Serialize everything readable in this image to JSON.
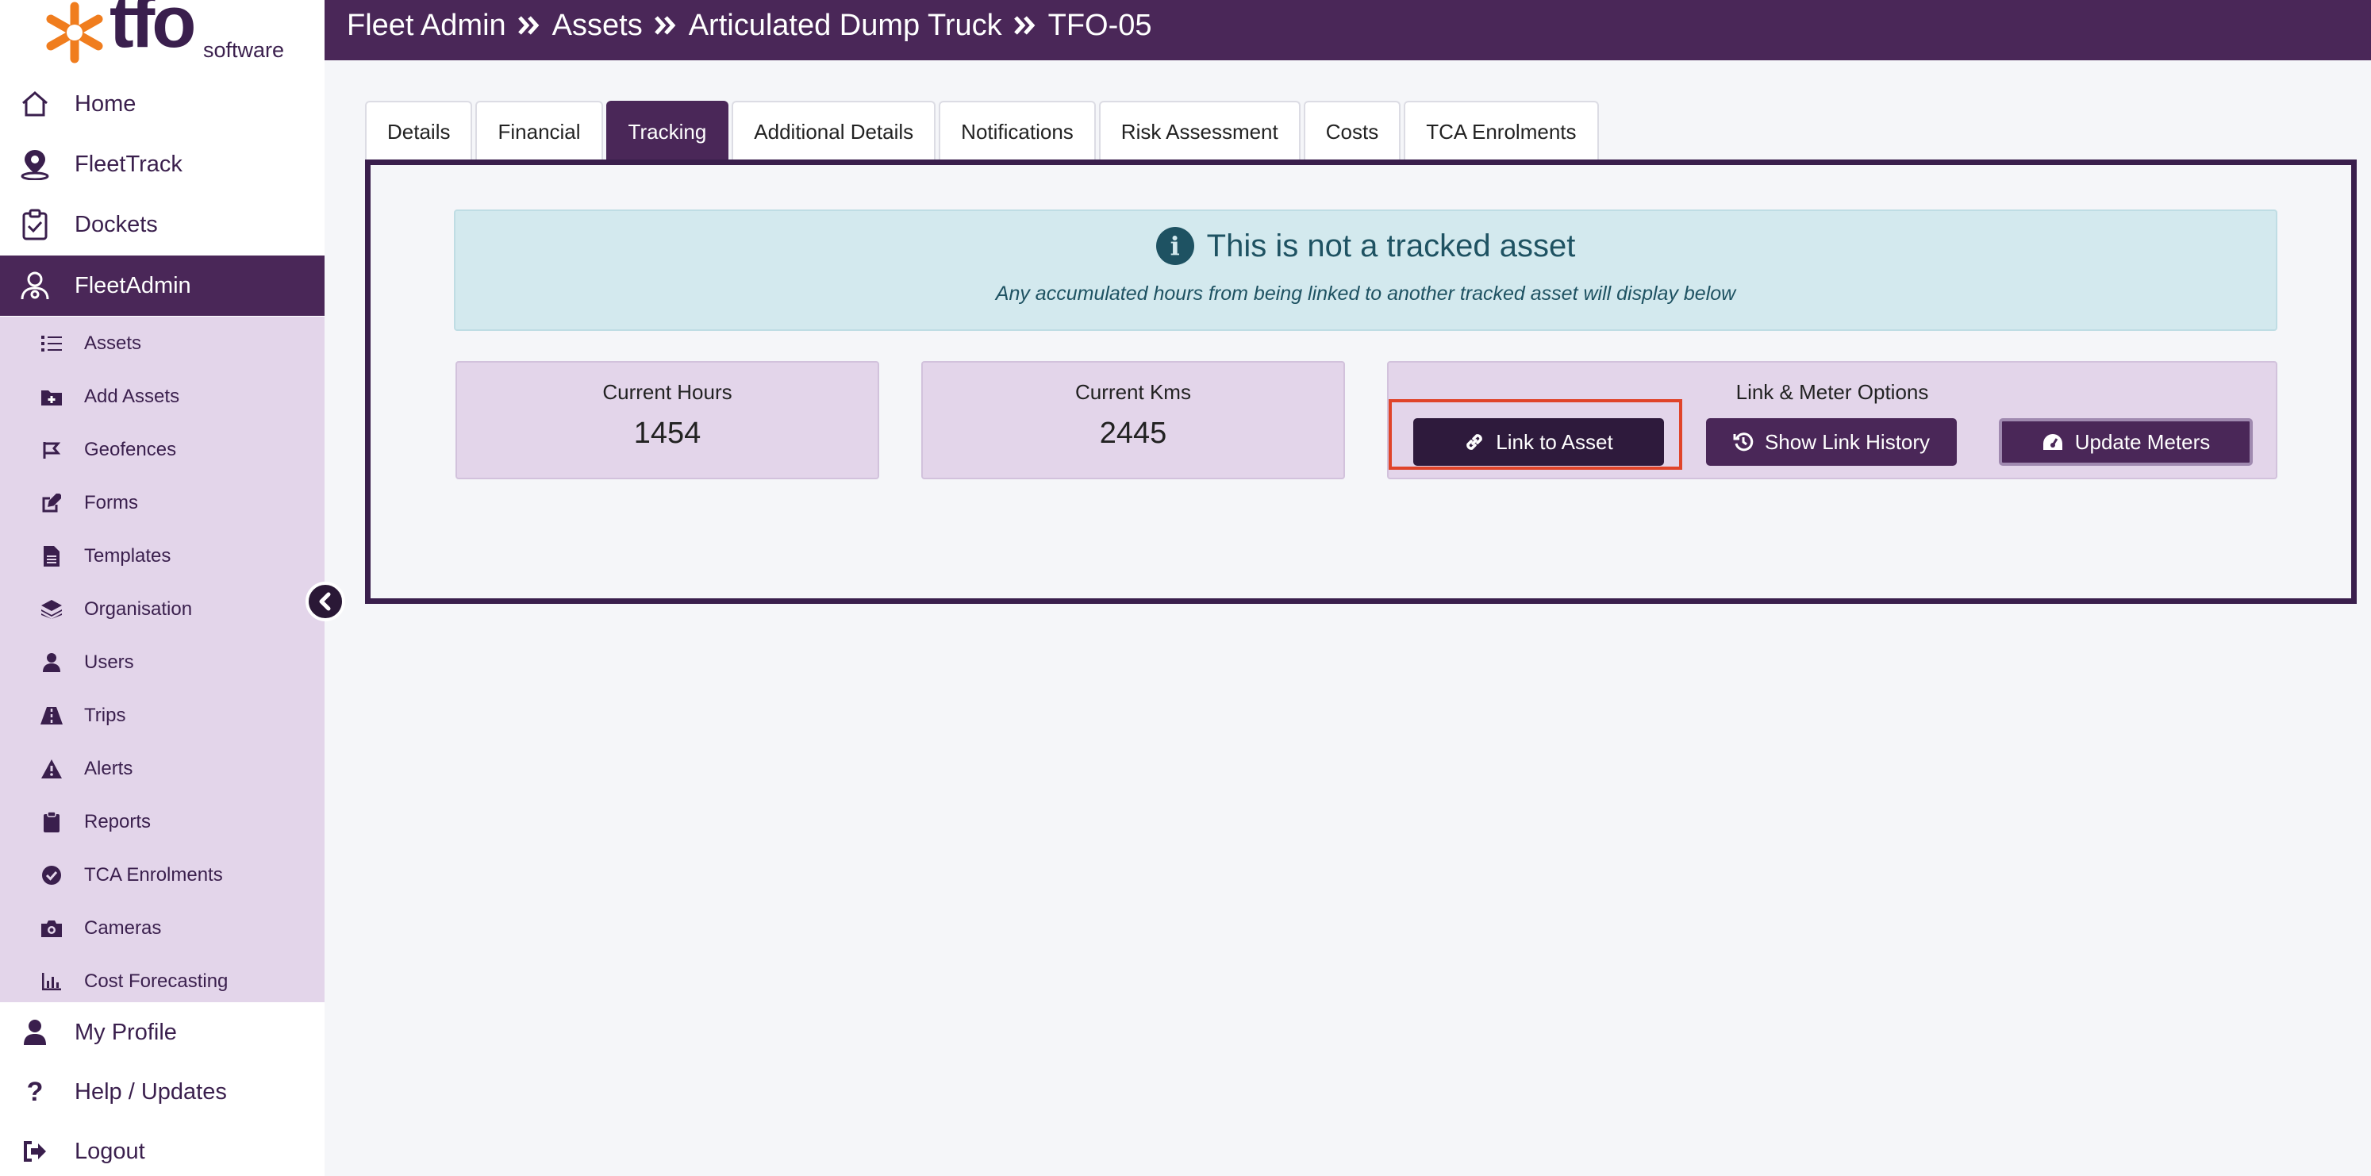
{
  "brand": {
    "logo_text": "tfo",
    "logo_subtext": "software"
  },
  "header": {
    "breadcrumb": [
      "Fleet Admin",
      "Assets",
      "Articulated Dump Truck",
      "TFO-05"
    ]
  },
  "sidebar": {
    "main_items": [
      {
        "label": "Home",
        "icon": "home-icon"
      },
      {
        "label": "FleetTrack",
        "icon": "location-pin-icon"
      },
      {
        "label": "Dockets",
        "icon": "clipboard-check-icon"
      },
      {
        "label": "FleetAdmin",
        "icon": "user-gear-icon",
        "active": true
      }
    ],
    "sub_items": [
      {
        "label": "Assets",
        "icon": "list-icon"
      },
      {
        "label": "Add Assets",
        "icon": "folder-plus-icon"
      },
      {
        "label": "Geofences",
        "icon": "flag-icon"
      },
      {
        "label": "Forms",
        "icon": "edit-icon"
      },
      {
        "label": "Templates",
        "icon": "file-icon"
      },
      {
        "label": "Organisation",
        "icon": "layers-icon"
      },
      {
        "label": "Users",
        "icon": "user-icon"
      },
      {
        "label": "Trips",
        "icon": "road-icon"
      },
      {
        "label": "Alerts",
        "icon": "warning-icon"
      },
      {
        "label": "Reports",
        "icon": "clipboard-icon"
      },
      {
        "label": "TCA Enrolments",
        "icon": "check-circle-icon"
      },
      {
        "label": "Cameras",
        "icon": "camera-icon"
      },
      {
        "label": "Cost Forecasting",
        "icon": "bar-chart-icon"
      }
    ],
    "bottom_items": [
      {
        "label": "My Profile",
        "icon": "user-icon"
      },
      {
        "label": "Help / Updates",
        "icon": "question-icon"
      },
      {
        "label": "Logout",
        "icon": "logout-icon"
      }
    ]
  },
  "tabs": [
    {
      "label": "Details"
    },
    {
      "label": "Financial"
    },
    {
      "label": "Tracking",
      "active": true
    },
    {
      "label": "Additional Details"
    },
    {
      "label": "Notifications"
    },
    {
      "label": "Risk Assessment"
    },
    {
      "label": "Costs"
    },
    {
      "label": "TCA Enrolments"
    }
  ],
  "tracking": {
    "alert_title": "This is not a tracked asset",
    "alert_subtitle": "Any accumulated hours from being linked to another tracked asset will display below",
    "current_hours_label": "Current Hours",
    "current_hours_value": "1454",
    "current_kms_label": "Current Kms",
    "current_kms_value": "2445",
    "options_label": "Link & Meter Options",
    "link_button": "Link to Asset",
    "history_button": "Show Link History",
    "update_button": "Update Meters"
  },
  "colors": {
    "brand_purple": "#4a2758",
    "sidebar_sub_bg": "#e3d5ea",
    "logo_orange": "#f07d1e",
    "alert_bg": "#d3e9ee",
    "highlight_red": "#e0442a"
  }
}
